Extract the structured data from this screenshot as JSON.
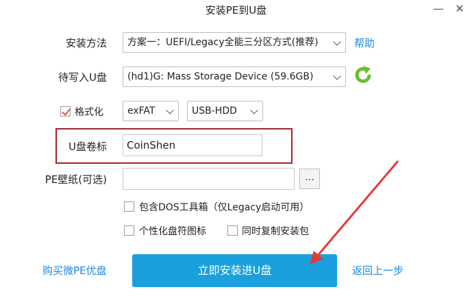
{
  "window": {
    "title": "安装PE到U盘",
    "minimize_glyph": "—",
    "close_glyph": "✕"
  },
  "install_method": {
    "label": "安装方法",
    "selected": "方案一：UEFI/Legacy全能三分区方式(推荐)",
    "help_link": "帮助"
  },
  "target_drive": {
    "label": "待写入U盘",
    "selected": "(hd1)G: Mass Storage Device (59.6GB)",
    "refresh_icon": "refresh-icon"
  },
  "format": {
    "label": "格式化",
    "checked": true,
    "filesystem": "exFAT",
    "mode": "USB-HDD"
  },
  "volume_label": {
    "label": "U盘卷标",
    "value": "CoinShen"
  },
  "wallpaper": {
    "label": "PE壁纸(可选)",
    "value": "",
    "browse_label": "..."
  },
  "options": {
    "dos_tools": "包含DOS工具箱（仅Legacy启动可用）",
    "custom_icon": "个性化盘符图标",
    "copy_package": "同时复制安装包"
  },
  "footer": {
    "buy_link": "购买微PE优盘",
    "install_button": "立即安装进U盘",
    "back_link": "返回上一步"
  },
  "colors": {
    "accent": "#1aa0dc",
    "link": "#1e88e5",
    "highlight": "#a4232b",
    "arrow": "#e53935",
    "refresh": "#6cbf2a"
  }
}
